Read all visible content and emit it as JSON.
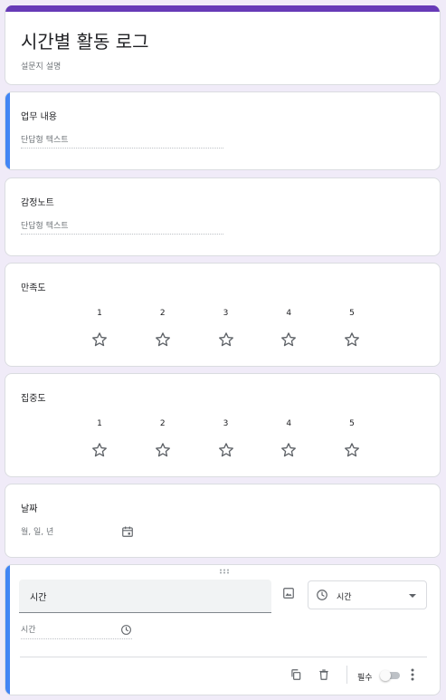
{
  "form": {
    "title": "시간별 활동 로그",
    "description": "설문지 설명"
  },
  "questions": [
    {
      "title": "업무 내용",
      "type": "short_answer",
      "placeholder": "단답형 텍스트"
    },
    {
      "title": "감정노트",
      "type": "short_answer",
      "placeholder": "단답형 텍스트"
    }
  ],
  "ratings": [
    {
      "title": "만족도",
      "scale": [
        "1",
        "2",
        "3",
        "4",
        "5"
      ]
    },
    {
      "title": "집중도",
      "scale": [
        "1",
        "2",
        "3",
        "4",
        "5"
      ]
    }
  ],
  "date_question": {
    "title": "날짜",
    "placeholder": "월, 일, 년",
    "icon": "calendar-icon"
  },
  "editing_question": {
    "title_value": "시간",
    "type_label": "시간",
    "answer_placeholder": "시간",
    "required_label": "필수",
    "required_on": false
  },
  "colors": {
    "theme": "#673ab7",
    "active_accent": "#4285f4",
    "background": "#f0ebf8"
  }
}
